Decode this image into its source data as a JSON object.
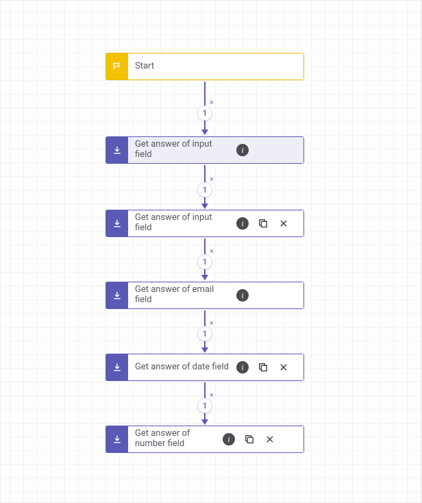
{
  "colors": {
    "start": "#f2c200",
    "action": "#5a5ab5",
    "grid": "#f0f0f0"
  },
  "connector_badge": "1",
  "connector_x": "×",
  "nodes": {
    "start": {
      "label": "Start"
    },
    "n1": {
      "label": "Get answer of input field"
    },
    "n2": {
      "label": "Get answer of input field"
    },
    "n3": {
      "label": "Get answer of email field"
    },
    "n4": {
      "label": "Get answer of date field"
    },
    "n5": {
      "label": "Get answer of number field"
    }
  }
}
